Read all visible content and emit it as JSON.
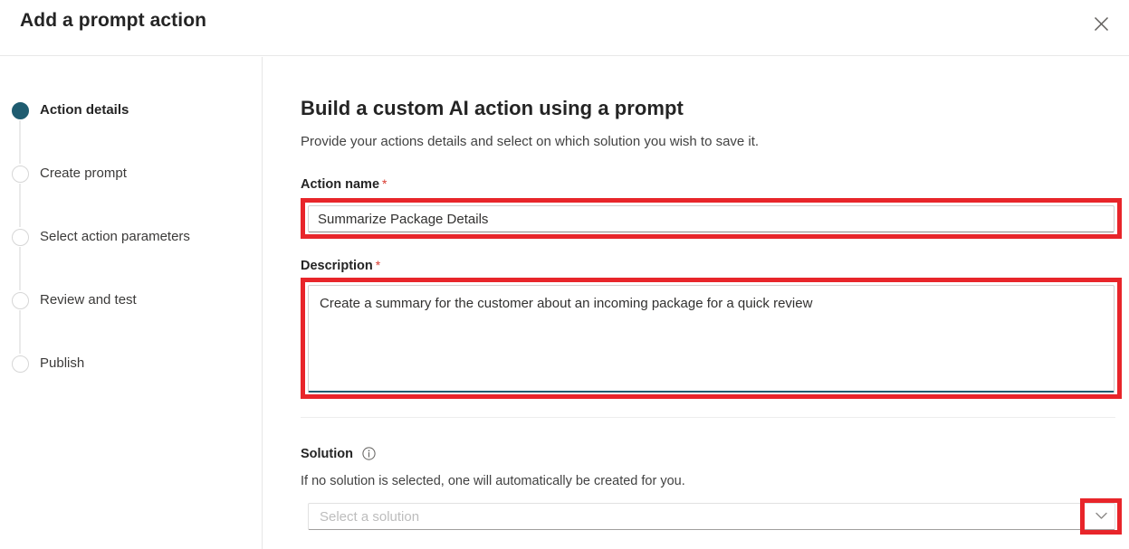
{
  "dialog": {
    "title": "Add a prompt action",
    "close_icon": "close-icon"
  },
  "stepper": {
    "items": [
      {
        "label": "Action details",
        "state": "active"
      },
      {
        "label": "Create prompt",
        "state": "inactive"
      },
      {
        "label": "Select action parameters",
        "state": "inactive"
      },
      {
        "label": "Review and test",
        "state": "inactive"
      },
      {
        "label": "Publish",
        "state": "inactive"
      }
    ]
  },
  "main": {
    "heading": "Build a custom AI action using a prompt",
    "subheading": "Provide your actions details and select on which solution you wish to save it.",
    "action_name": {
      "label": "Action name",
      "required_marker": "*",
      "value": "Summarize Package Details",
      "placeholder": ""
    },
    "description": {
      "label": "Description",
      "required_marker": "*",
      "value": "Create a summary for the customer about an incoming package for a quick review",
      "placeholder": ""
    },
    "solution": {
      "label": "Solution",
      "info_icon": "info-circle-icon",
      "helper": "If no solution is selected, one will automatically be created for you.",
      "placeholder": "Select a solution",
      "value": "",
      "chevron_icon": "chevron-down-icon"
    }
  },
  "colors": {
    "accent": "#1f5c70",
    "annotation": "#e8252a",
    "required": "#d93b30",
    "text_primary": "#242424",
    "text_secondary": "#424242",
    "border": "#d1d1d1"
  }
}
